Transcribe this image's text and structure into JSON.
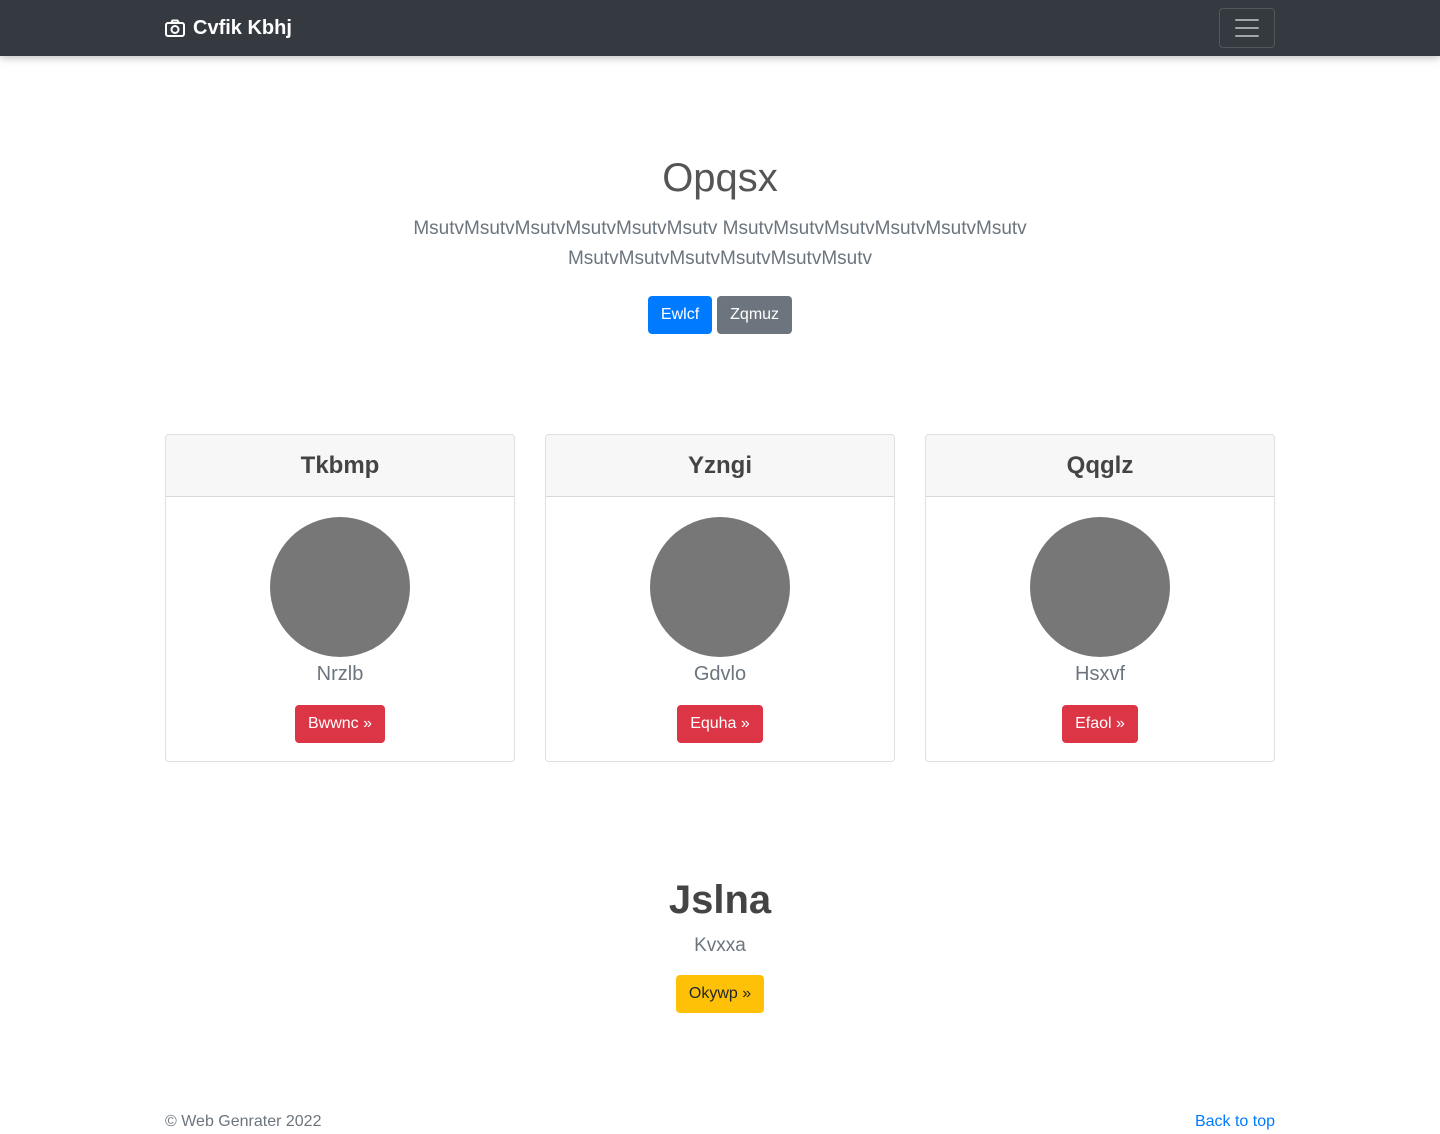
{
  "navbar": {
    "brand": "Cvfik Kbhj",
    "brand_icon": "camera-icon"
  },
  "hero": {
    "title": "Opqsx",
    "lead": "MsutvMsutvMsutvMsutvMsutvMsutv MsutvMsutvMsutvMsutvMsutvMsutv MsutvMsutvMsutvMsutvMsutvMsutv",
    "primary_button": "Ewlcf",
    "secondary_button": "Zqmuz"
  },
  "cards": [
    {
      "title": "Tkbmp",
      "name": "Nrzlb",
      "button": "Bwwnc »"
    },
    {
      "title": "Yzngi",
      "name": "Gdvlo",
      "button": "Equha »"
    },
    {
      "title": "Qqglz",
      "name": "Hsxvf",
      "button": "Efaol »"
    }
  ],
  "cta": {
    "title": "Jslna",
    "subtitle": "Kvxxa",
    "button": "Okywp »"
  },
  "footer": {
    "copyright": "© Web Genrater 2022",
    "back_to_top": "Back to top"
  },
  "colors": {
    "navbar": "#343a40",
    "primary": "#007bff",
    "secondary": "#6c757d",
    "danger": "#dc3545",
    "warning": "#ffc107",
    "avatar": "#777777"
  }
}
